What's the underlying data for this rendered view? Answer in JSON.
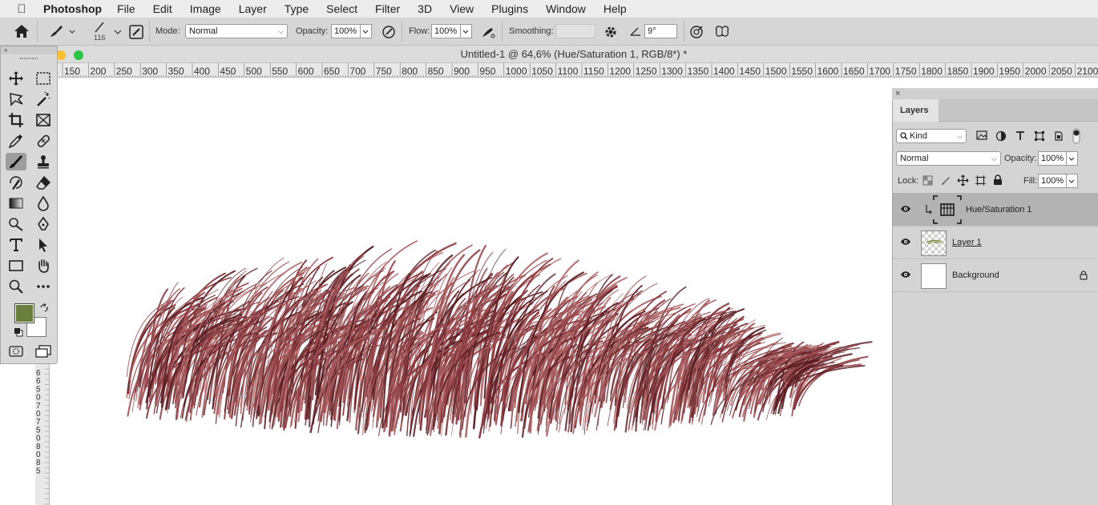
{
  "menubar": {
    "app_name": "Photoshop",
    "menus": [
      "File",
      "Edit",
      "Image",
      "Layer",
      "Type",
      "Select",
      "Filter",
      "3D",
      "View",
      "Plugins",
      "Window",
      "Help"
    ]
  },
  "options_bar": {
    "brush_size": "116",
    "mode_label": "Mode:",
    "mode_value": "Normal",
    "opacity_label": "Opacity:",
    "opacity_value": "100%",
    "flow_label": "Flow:",
    "flow_value": "100%",
    "smoothing_label": "Smoothing:",
    "smoothing_value": "",
    "angle_value": "9°"
  },
  "document": {
    "title": "Untitled-1 @ 64,6% (Hue/Saturation 1, RGB/8*) *",
    "ruler_top": [
      "150",
      "200",
      "250",
      "300",
      "350",
      "400",
      "450",
      "500",
      "550",
      "600",
      "650",
      "700",
      "750",
      "800",
      "850",
      "900",
      "950",
      "1000",
      "1050",
      "1100",
      "1150",
      "1200",
      "1250",
      "1300",
      "1350",
      "1400",
      "1450",
      "1500",
      "1550",
      "1600",
      "1650",
      "1700",
      "1750",
      "1800",
      "1850",
      "1900",
      "1950",
      "2000",
      "2050",
      "2100"
    ],
    "ruler_left": [
      "6",
      "6",
      "5",
      "0",
      "7",
      "0",
      "7",
      "5",
      "0",
      "8",
      "0",
      "8",
      "5"
    ]
  },
  "toolbar": {
    "foreground_color": "#6a7f3d",
    "background_color": "#ffffff"
  },
  "layers_panel": {
    "tab_label": "Layers",
    "filter_kind": "Kind",
    "blend_mode": "Normal",
    "opacity_label": "Opacity:",
    "opacity_value": "100%",
    "lock_label": "Lock:",
    "fill_label": "Fill:",
    "fill_value": "100%",
    "layers": [
      {
        "name": "Hue/Saturation 1",
        "type": "adjustment",
        "selected": true
      },
      {
        "name": "Layer 1",
        "type": "pixel",
        "selected": false
      },
      {
        "name": "Background",
        "type": "background",
        "locked": true,
        "selected": false
      }
    ]
  },
  "colors": {
    "grass_dark": "#5a1f24",
    "grass_mid": "#8b3a3f",
    "grass_light": "#a85a5c"
  }
}
